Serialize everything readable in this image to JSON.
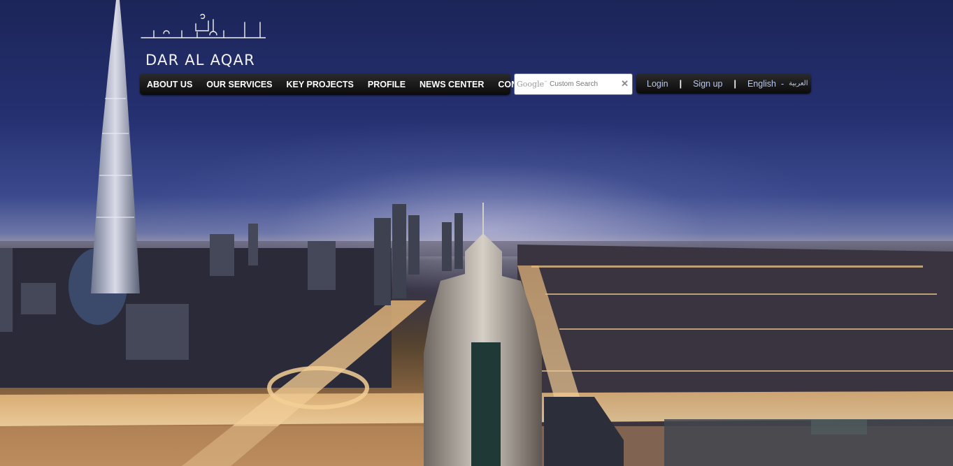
{
  "logo": {
    "arabic_text": "دار العقار",
    "english_text": "DAR AL AQAR"
  },
  "nav": {
    "items": [
      {
        "label": "ABOUT US"
      },
      {
        "label": "OUR SERVICES"
      },
      {
        "label": "KEY PROJECTS"
      },
      {
        "label": "PROFILE"
      },
      {
        "label": "NEWS CENTER"
      },
      {
        "label": "CONTACT"
      }
    ]
  },
  "search": {
    "brand": "Google",
    "brand_tm": "™",
    "placeholder": "Custom Search",
    "clear_symbol": "✕"
  },
  "user": {
    "login_label": "Login",
    "signup_label": "Sign up",
    "separator": "|",
    "lang_english": "English",
    "lang_separator": "-",
    "lang_arabic": "العربية"
  },
  "background": {
    "scene": "Dubai skyline at night",
    "sky_color": "#1c2558",
    "glow_color": "#d7d2eb",
    "city_light_color": "#c18f5f"
  }
}
